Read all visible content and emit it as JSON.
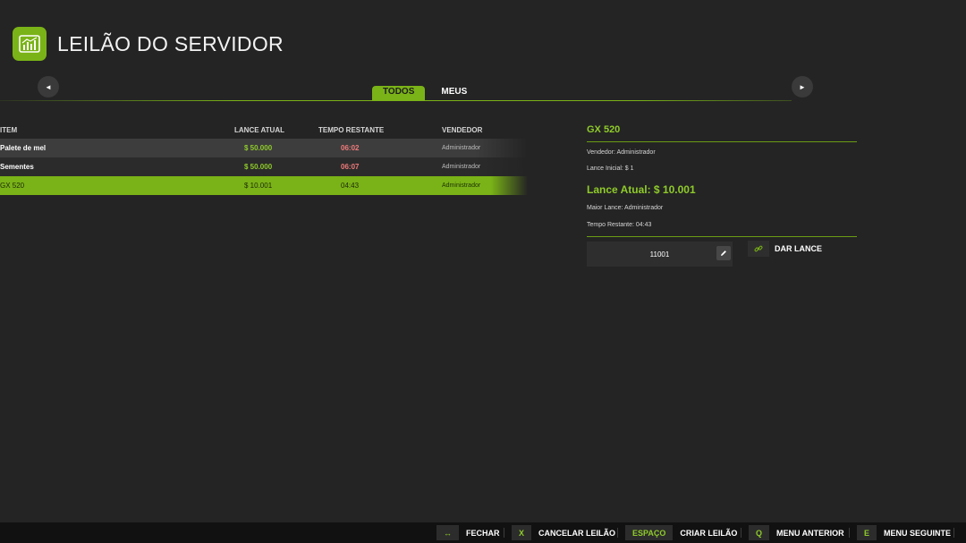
{
  "header": {
    "title": "LEILÃO DO SERVIDOR",
    "icon": "chart-icon",
    "accent": "#7ab317"
  },
  "nav": {
    "prev_icon": "◄",
    "next_icon": "►"
  },
  "tabs": [
    {
      "label": "TODOS",
      "active": true
    },
    {
      "label": "MEUS",
      "active": false
    }
  ],
  "table": {
    "headers": {
      "item": "ITEM",
      "bid": "LANCE ATUAL",
      "time": "TEMPO RESTANTE",
      "seller": "VENDEDOR"
    },
    "rows": [
      {
        "item": "Palete de mel",
        "bid": "$ 50.000",
        "time": "06:02",
        "seller": "Administrador"
      },
      {
        "item": "Sementes",
        "bid": "$ 50.000",
        "time": "06:07",
        "seller": "Administrador"
      },
      {
        "item": "GX 520",
        "bid": "$ 10.001",
        "time": "04:43",
        "seller": "Administrador"
      }
    ]
  },
  "details": {
    "title": "GX 520",
    "seller": "Vendedor: Administrador",
    "initial_bid": "Lance Inicial: $ 1",
    "current_bid": "Lance Atual: $ 10.001",
    "highest_bidder": "Maior Lance: Administrador",
    "time_left": "Tempo Restante: 04:43",
    "bid_value": "11001",
    "bid_button": "DAR LANCE"
  },
  "footer": [
    {
      "key": "↔",
      "label": "FECHAR"
    },
    {
      "key": "X",
      "label": "CANCELAR LEILÃO"
    },
    {
      "key": "ESPAÇO",
      "label": "CRIAR LEILÃO"
    },
    {
      "key": "Q",
      "label": "MENU ANTERIOR"
    },
    {
      "key": "E",
      "label": "MENU SEGUINTE"
    }
  ]
}
